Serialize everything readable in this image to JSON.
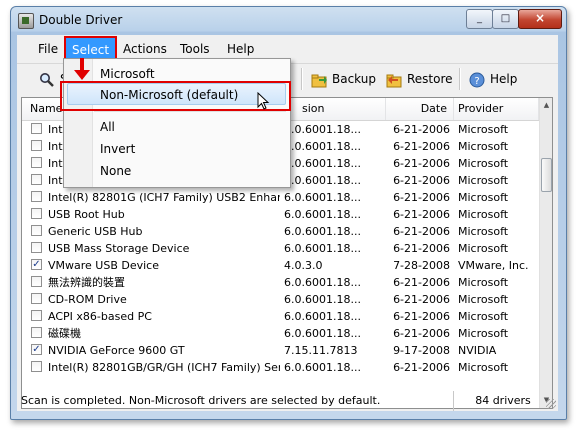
{
  "window": {
    "title": "Double Driver",
    "min_glyph": "_",
    "max_glyph": "□",
    "close_glyph": "×"
  },
  "menubar": {
    "items": [
      "File",
      "Select",
      "Actions",
      "Tools",
      "Help"
    ]
  },
  "toolbar": {
    "scan_label": "S",
    "backup_label": "Backup",
    "restore_label": "Restore",
    "help_label": "Help"
  },
  "select_menu": {
    "items": [
      "Microsoft",
      "Non-Microsoft (default)",
      "All",
      "Invert",
      "None"
    ],
    "highlighted": "Non-Microsoft (default)"
  },
  "table": {
    "columns": [
      "Name",
      "sion",
      "Date",
      "Provider"
    ],
    "rows": [
      {
        "checked": false,
        "name": "Intel(",
        "version": "6.0.6001.18...",
        "date": "6-21-2006",
        "provider": "Microsoft"
      },
      {
        "checked": false,
        "name": "Intel(",
        "version": "6.0.6001.18...",
        "date": "6-21-2006",
        "provider": "Microsoft"
      },
      {
        "checked": false,
        "name": "Intel(",
        "version": "6.0.6001.18...",
        "date": "6-21-2006",
        "provider": "Microsoft"
      },
      {
        "checked": false,
        "name": "Intel(",
        "version": "6.0.6001.18...",
        "date": "6-21-2006",
        "provider": "Microsoft"
      },
      {
        "checked": false,
        "name": "Intel(R) 82801G (ICH7 Family) USB2 Enhanc...",
        "version": "6.0.6001.18...",
        "date": "6-21-2006",
        "provider": "Microsoft"
      },
      {
        "checked": false,
        "name": "USB Root Hub",
        "version": "6.0.6001.18...",
        "date": "6-21-2006",
        "provider": "Microsoft"
      },
      {
        "checked": false,
        "name": "Generic USB Hub",
        "version": "6.0.6001.18...",
        "date": "6-21-2006",
        "provider": "Microsoft"
      },
      {
        "checked": false,
        "name": "USB Mass Storage Device",
        "version": "6.0.6001.18...",
        "date": "6-21-2006",
        "provider": "Microsoft"
      },
      {
        "checked": true,
        "name": "VMware USB Device",
        "version": "4.0.3.0",
        "date": "7-28-2008",
        "provider": "VMware, Inc."
      },
      {
        "checked": false,
        "name": "無法辨識的裝置",
        "version": "6.0.6001.18...",
        "date": "6-21-2006",
        "provider": "Microsoft"
      },
      {
        "checked": false,
        "name": "CD-ROM Drive",
        "version": "6.0.6001.18...",
        "date": "6-21-2006",
        "provider": "Microsoft"
      },
      {
        "checked": false,
        "name": "ACPI x86-based PC",
        "version": "6.0.6001.18...",
        "date": "6-21-2006",
        "provider": "Microsoft"
      },
      {
        "checked": false,
        "name": "磁碟機",
        "version": "6.0.6001.18...",
        "date": "6-21-2006",
        "provider": "Microsoft"
      },
      {
        "checked": true,
        "name": "NVIDIA GeForce 9600 GT",
        "version": "7.15.11.7813",
        "date": "9-17-2008",
        "provider": "NVIDIA"
      },
      {
        "checked": false,
        "name": "Intel(R) 82801GB/GR/GH (ICH7 Family) Serial...",
        "version": "6.0.6001.18...",
        "date": "6-21-2006",
        "provider": "Microsoft"
      }
    ]
  },
  "status": {
    "message": "Scan is completed. Non-Microsoft drivers are selected by default.",
    "count": "84 drivers"
  },
  "colors": {
    "menu_highlight": "#3399ff",
    "annotation_red": "#e00000"
  }
}
